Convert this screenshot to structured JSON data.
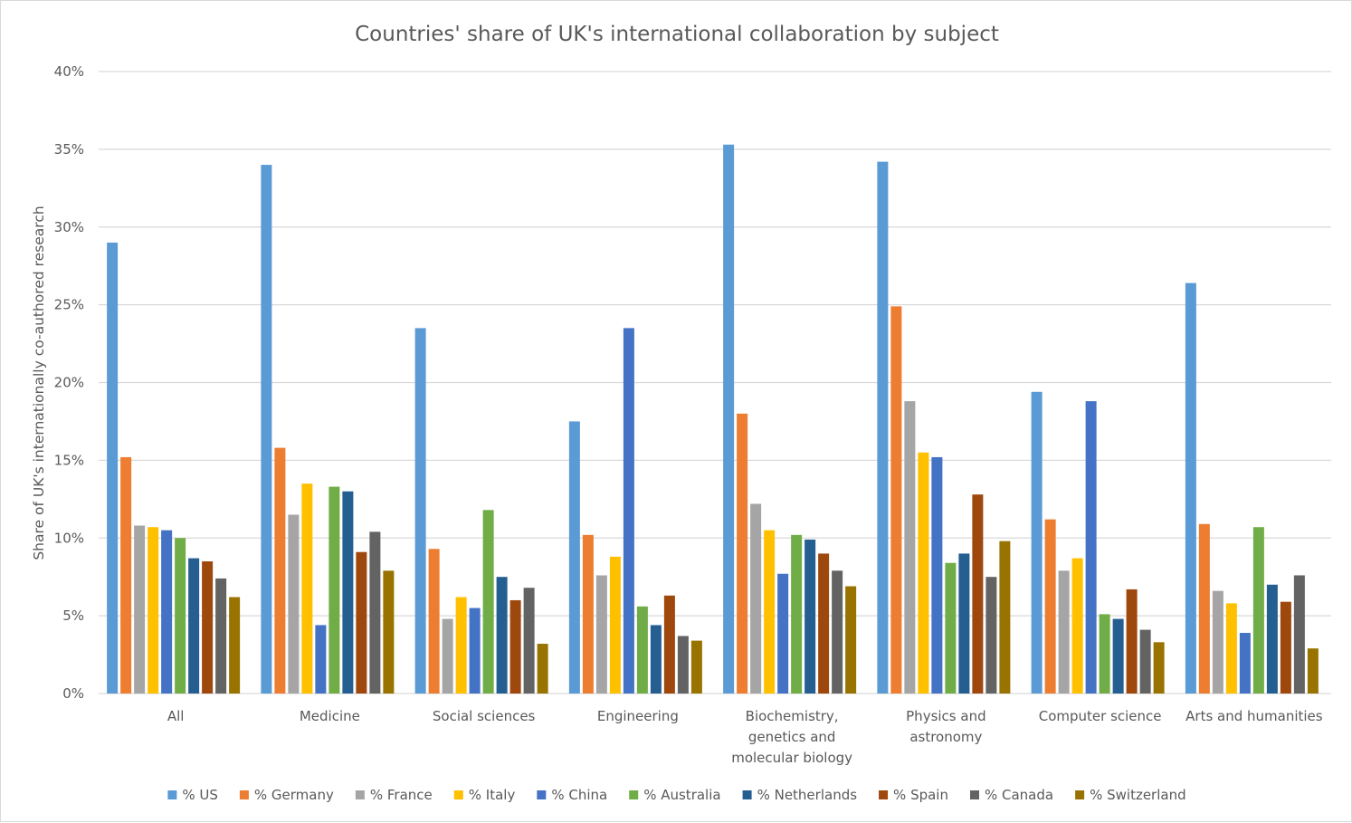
{
  "chart_data": {
    "type": "bar",
    "title": "Countries' share of UK's international collaboration by subject",
    "xlabel": "",
    "ylabel": "Share of UK's internationally co-authored research",
    "ylim": [
      0,
      40
    ],
    "yticks": [
      0,
      5,
      10,
      15,
      20,
      25,
      30,
      35,
      40
    ],
    "ytick_labels": [
      "0%",
      "5%",
      "10%",
      "15%",
      "20%",
      "25%",
      "30%",
      "35%",
      "40%"
    ],
    "grid": true,
    "legend_position": "bottom",
    "categories": [
      "All",
      "Medicine",
      "Social sciences",
      "Engineering",
      "Biochemistry, genetics and molecular biology",
      "Physics and astronomy",
      "Computer science",
      "Arts and humanities"
    ],
    "category_label_lines": [
      [
        "All"
      ],
      [
        "Medicine"
      ],
      [
        "Social sciences"
      ],
      [
        "Engineering"
      ],
      [
        "Biochemistry,",
        "genetics and",
        "molecular biology"
      ],
      [
        "Physics and",
        "astronomy"
      ],
      [
        "Computer science"
      ],
      [
        "Arts and humanities"
      ]
    ],
    "series": [
      {
        "name": "% US",
        "color": "#5B9BD5",
        "values": [
          29.0,
          34.0,
          23.5,
          17.5,
          35.3,
          34.2,
          19.4,
          26.4
        ]
      },
      {
        "name": "% Germany",
        "color": "#ED7D31",
        "values": [
          15.2,
          15.8,
          9.3,
          10.2,
          18.0,
          24.9,
          11.2,
          10.9
        ]
      },
      {
        "name": "% France",
        "color": "#A5A5A5",
        "values": [
          10.8,
          11.5,
          4.8,
          7.6,
          12.2,
          18.8,
          7.9,
          6.6
        ]
      },
      {
        "name": "% Italy",
        "color": "#FFC000",
        "values": [
          10.7,
          13.5,
          6.2,
          8.8,
          10.5,
          15.5,
          8.7,
          5.8
        ]
      },
      {
        "name": "% China",
        "color": "#4472C4",
        "values": [
          10.5,
          4.4,
          5.5,
          23.5,
          7.7,
          15.2,
          18.8,
          3.9
        ]
      },
      {
        "name": "% Australia",
        "color": "#70AD47",
        "values": [
          10.0,
          13.3,
          11.8,
          5.6,
          10.2,
          8.4,
          5.1,
          10.7
        ]
      },
      {
        "name": "% Netherlands",
        "color": "#255E91",
        "values": [
          8.7,
          13.0,
          7.5,
          4.4,
          9.9,
          9.0,
          4.8,
          7.0
        ]
      },
      {
        "name": "% Spain",
        "color": "#9E480E",
        "values": [
          8.5,
          9.1,
          6.0,
          6.3,
          9.0,
          12.8,
          6.7,
          5.9
        ]
      },
      {
        "name": "% Canada",
        "color": "#636363",
        "values": [
          7.4,
          10.4,
          6.8,
          3.7,
          7.9,
          7.5,
          4.1,
          7.6
        ]
      },
      {
        "name": "% Switzerland",
        "color": "#997300",
        "values": [
          6.2,
          7.9,
          3.2,
          3.4,
          6.9,
          9.8,
          3.3,
          2.9
        ]
      }
    ]
  }
}
